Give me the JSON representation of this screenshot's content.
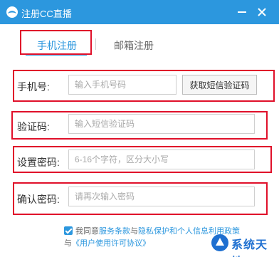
{
  "window": {
    "title": "注册CC直播"
  },
  "tabs": {
    "phone": "手机注册",
    "email": "邮箱注册",
    "active": "phone"
  },
  "form": {
    "phone_label": "手机号:",
    "phone_placeholder": "输入手机号码",
    "get_code_button": "获取短信验证码",
    "code_label": "验证码:",
    "code_placeholder": "输入短信验证码",
    "password_label": "设置密码:",
    "password_placeholder": "6-16个字符，区分大小写",
    "confirm_label": "确认密码:",
    "confirm_placeholder": "请再次输入密码"
  },
  "agreement": {
    "checked": true,
    "prefix": "我同意",
    "terms": "服务条款",
    "and1": "与",
    "privacy": "隐私保护和个人信息利用政策",
    "and2": "与",
    "license": "《用户使用许可协议》"
  },
  "watermark": {
    "text": "系统天地"
  },
  "colors": {
    "accent": "#2c97de",
    "highlight": "#e0102a",
    "watermark": "#1e6fd0"
  }
}
